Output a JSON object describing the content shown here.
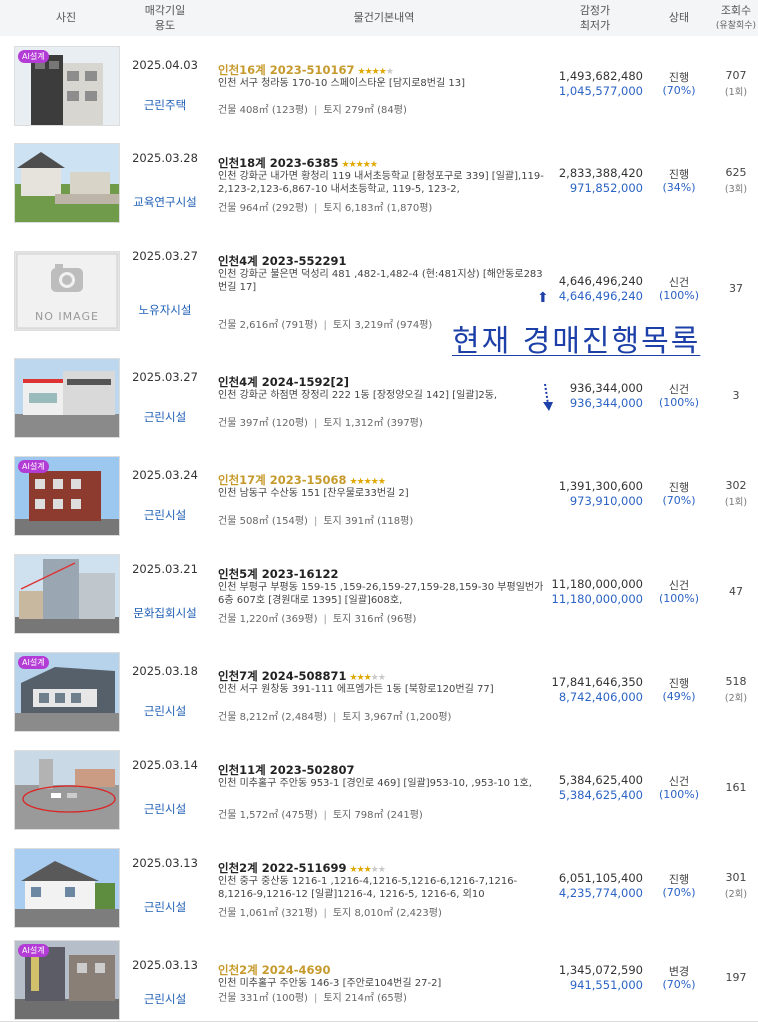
{
  "header": {
    "photo": "사진",
    "sale_date": "매각기일",
    "usage": "용도",
    "item_info": "물건기본내역",
    "appraisal": "감정가",
    "min_price": "최저가",
    "status": "상태",
    "views": "조회수",
    "fails": "(유찰회수)"
  },
  "overlay_text": "현재 경매진행목록",
  "badge_text": "AI설계",
  "listings": [
    {
      "date": "2025.04.03",
      "usage": "근린주택",
      "case": "인천16계 2023-510167",
      "stars": 4,
      "highlight": true,
      "address": "인천 서구 청라동 170-10 스페이스타운 [담지로8번길 13]",
      "building": "건물 408㎡ (123평)",
      "land": "토지 279㎡ (84평)",
      "appraisal": "1,493,682,480",
      "min_price": "1,045,577,000",
      "status": "진행",
      "pct": "(70%)",
      "views": "707",
      "fails": "(1회)",
      "ai": true
    },
    {
      "date": "2025.03.28",
      "usage": "교육연구시설",
      "case": "인천18계 2023-6385",
      "stars": 5,
      "highlight": false,
      "address": "인천 강화군 내가면 황청리 119 내서초등학교 [황청포구로 339] [일괄],119-2,123-2,123-6,867-10 내서초등학교, 119-5, 123-2,",
      "building": "건물 964㎡ (292평)",
      "land": "토지 6,183㎡ (1,870평)",
      "appraisal": "2,833,388,420",
      "min_price": "971,852,000",
      "status": "진행",
      "pct": "(34%)",
      "views": "625",
      "fails": "(3회)",
      "ai": false
    },
    {
      "date": "2025.03.27",
      "usage": "노유자시설",
      "case": "인천4계 2023-552291",
      "stars": 0,
      "highlight": false,
      "address": "인천 강화군 불은면 덕성리 481 ,482-1,482-4 (현:481지상) [해안동로283번길 17]",
      "building": "건물 2,616㎡ (791평)",
      "land": "토지 3,219㎡ (974평)",
      "appraisal": "4,646,496,240",
      "min_price": "4,646,496,240",
      "status": "신건",
      "pct": "(100%)",
      "views": "37",
      "fails": "",
      "ai": false,
      "noimage": "NO IMAGE"
    },
    {
      "date": "2025.03.27",
      "usage": "근린시설",
      "case": "인천4계 2024-1592[2]",
      "stars": 0,
      "highlight": false,
      "address": "인천 강화군 하점면 장정리 222 1동 [장정양오길 142] [일괄]2동,",
      "building": "건물 397㎡ (120평)",
      "land": "토지 1,312㎡ (397평)",
      "appraisal": "936,344,000",
      "min_price": "936,344,000",
      "status": "신건",
      "pct": "(100%)",
      "views": "3",
      "fails": "",
      "ai": false
    },
    {
      "date": "2025.03.24",
      "usage": "근린시설",
      "case": "인천17계 2023-15068",
      "stars": 5,
      "highlight": true,
      "address": "인천 남동구 수산동 151 [찬우물로33번길 2]",
      "building": "건물 508㎡ (154평)",
      "land": "토지 391㎡ (118평)",
      "appraisal": "1,391,300,600",
      "min_price": "973,910,000",
      "status": "진행",
      "pct": "(70%)",
      "views": "302",
      "fails": "(1회)",
      "ai": true
    },
    {
      "date": "2025.03.21",
      "usage": "문화집회시설",
      "case": "인천5계 2023-16122",
      "stars": 0,
      "highlight": false,
      "address": "인천 부평구 부평동 159-15 ,159-26,159-27,159-28,159-30 부평일번가 6층 607호 [경원대로 1395] [일괄]608호,",
      "building": "건물 1,220㎡ (369평)",
      "land": "토지 316㎡ (96평)",
      "appraisal": "11,180,000,000",
      "min_price": "11,180,000,000",
      "status": "신건",
      "pct": "(100%)",
      "views": "47",
      "fails": "",
      "ai": false
    },
    {
      "date": "2025.03.18",
      "usage": "근린시설",
      "case": "인천7계 2024-508871",
      "stars": 3,
      "highlight": false,
      "address": "인천 서구 원창동 391-111 에프엠가든 1동 [북항로120번길 77]",
      "building": "건물 8,212㎡ (2,484평)",
      "land": "토지 3,967㎡ (1,200평)",
      "appraisal": "17,841,646,350",
      "min_price": "8,742,406,000",
      "status": "진행",
      "pct": "(49%)",
      "views": "518",
      "fails": "(2회)",
      "ai": true
    },
    {
      "date": "2025.03.14",
      "usage": "근린시설",
      "case": "인천11계 2023-502807",
      "stars": 0,
      "highlight": false,
      "address": "인천 미추홀구 주안동 953-1 [경인로 469] [일괄]953-10, ,953-10 1호,",
      "building": "건물 1,572㎡ (475평)",
      "land": "토지 798㎡ (241평)",
      "appraisal": "5,384,625,400",
      "min_price": "5,384,625,400",
      "status": "신건",
      "pct": "(100%)",
      "views": "161",
      "fails": "",
      "ai": false
    },
    {
      "date": "2025.03.13",
      "usage": "근린시설",
      "case": "인천2계 2022-511699",
      "stars": 3,
      "highlight": false,
      "address": "인천 중구 중산동 1216-1 ,1216-4,1216-5,1216-6,1216-7,1216-8,1216-9,1216-12 [일괄]1216-4, 1216-5, 1216-6, 외10",
      "building": "건물 1,061㎡ (321평)",
      "land": "토지 8,010㎡ (2,423평)",
      "appraisal": "6,051,105,400",
      "min_price": "4,235,774,000",
      "status": "진행",
      "pct": "(70%)",
      "views": "301",
      "fails": "(2회)",
      "ai": false
    },
    {
      "date": "2025.03.13",
      "usage": "근린시설",
      "case": "인천2계 2024-4690",
      "stars": 0,
      "highlight": true,
      "address": "인천 미추홀구 주안동 146-3 [주안로104번길 27-2]",
      "building": "건물 331㎡ (100평)",
      "land": "토지 214㎡ (65평)",
      "appraisal": "1,345,072,590",
      "min_price": "941,551,000",
      "status": "변경",
      "pct": "(70%)",
      "views": "197",
      "fails": "",
      "ai": true
    }
  ]
}
